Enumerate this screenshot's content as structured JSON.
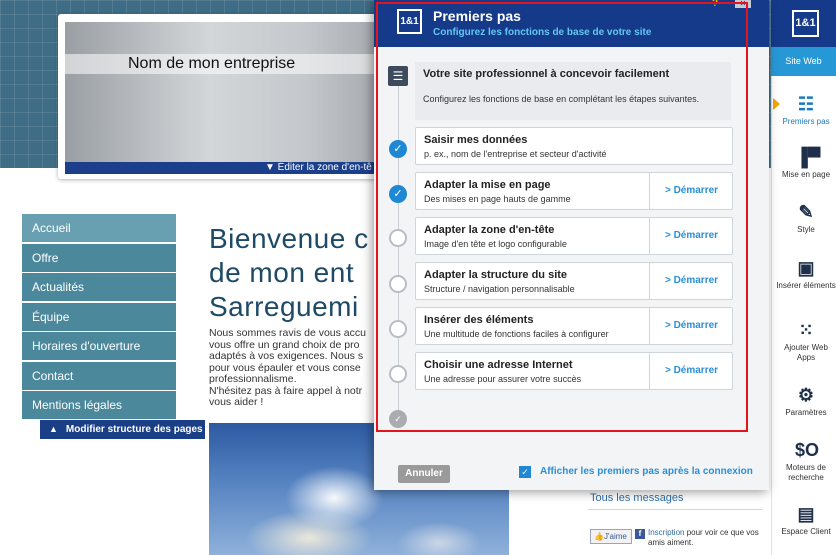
{
  "website": {
    "company_name": "Nom de mon entreprise",
    "edit_header_label": "▼ Éditer la zone d'en-tê",
    "nav_items": [
      "Accueil",
      "Offre",
      "Actualités",
      "Équipe",
      "Horaires d'ouverture",
      "Contact",
      "Mentions légales"
    ],
    "edit_structure_label": "Modifier structure des pages",
    "welcome_lines": [
      "Bienvenue c",
      "de mon ent",
      "Sarreguemi"
    ],
    "paragraph_lines": [
      "Nous sommes ravis de vous accu",
      "vous offre un grand choix de pro",
      "adaptés à vos exigences. Nous s",
      "pour vous épauler et vous conse",
      "professionnalisme.",
      "N'hésitez pas à faire appel à notr",
      "vous aider !"
    ],
    "all_messages": "Tous les messages",
    "like_label": "J'aime",
    "fb_link": "Inscription",
    "fb_text": " pour voir ce que vos amis aiment."
  },
  "sidebar": {
    "logo": "1&1",
    "site_web": "Site Web",
    "items": [
      {
        "label": "Premiers pas",
        "icon": "checklist-icon",
        "glyph": "☷",
        "active": true
      },
      {
        "label": "Mise en page",
        "icon": "layout-icon",
        "glyph": "▐▀",
        "active": false
      },
      {
        "label": "Style",
        "icon": "style-brush-icon",
        "glyph": "✎",
        "active": false
      },
      {
        "label": "Insérer éléments",
        "icon": "insert-element-icon",
        "glyph": "▣",
        "active": false
      },
      {
        "label": "Ajouter Web Apps",
        "icon": "web-apps-icon",
        "glyph": "⁙",
        "active": false
      },
      {
        "label": "Paramètres",
        "icon": "settings-gear-icon",
        "glyph": "⚙",
        "active": false
      },
      {
        "label": "Moteurs de recherche",
        "icon": "seo-icon",
        "glyph": "$O",
        "active": false
      },
      {
        "label": "Espace Client",
        "icon": "client-area-icon",
        "glyph": "▤",
        "active": false
      }
    ]
  },
  "modal": {
    "logo": "1&1",
    "title": "Premiers pas",
    "subtitle": "Configurez les fonctions de base de votre site",
    "intro_title": "Votre site professionnel à concevoir facilement",
    "intro_text": "Configurez les fonctions de base en complétant les étapes suivantes.",
    "steps": [
      {
        "title": "Saisir mes données",
        "desc": "p. ex., nom de l'entreprise et secteur d'activité",
        "done": true,
        "action": ""
      },
      {
        "title": "Adapter la mise en page",
        "desc": "Des mises en page hauts de gamme",
        "done": true,
        "action": "> Démarrer"
      },
      {
        "title": "Adapter la zone d'en-tête",
        "desc": "Image d'en tête et logo configurable",
        "done": false,
        "action": "> Démarrer"
      },
      {
        "title": "Adapter la structure du site",
        "desc": "Structure / navigation personnalisable",
        "done": false,
        "action": "> Démarrer"
      },
      {
        "title": "Insérer des éléments",
        "desc": "Une multitude de fonctions faciles à configurer",
        "done": false,
        "action": "> Démarrer"
      },
      {
        "title": "Choisir une adresse Internet",
        "desc": "Une adresse pour assurer votre succès",
        "done": false,
        "action": "> Démarrer"
      }
    ],
    "cancel_label": "Annuler",
    "show_checkbox_label": "Afficher les premiers pas après la connexion",
    "show_checkbox_checked": true
  }
}
